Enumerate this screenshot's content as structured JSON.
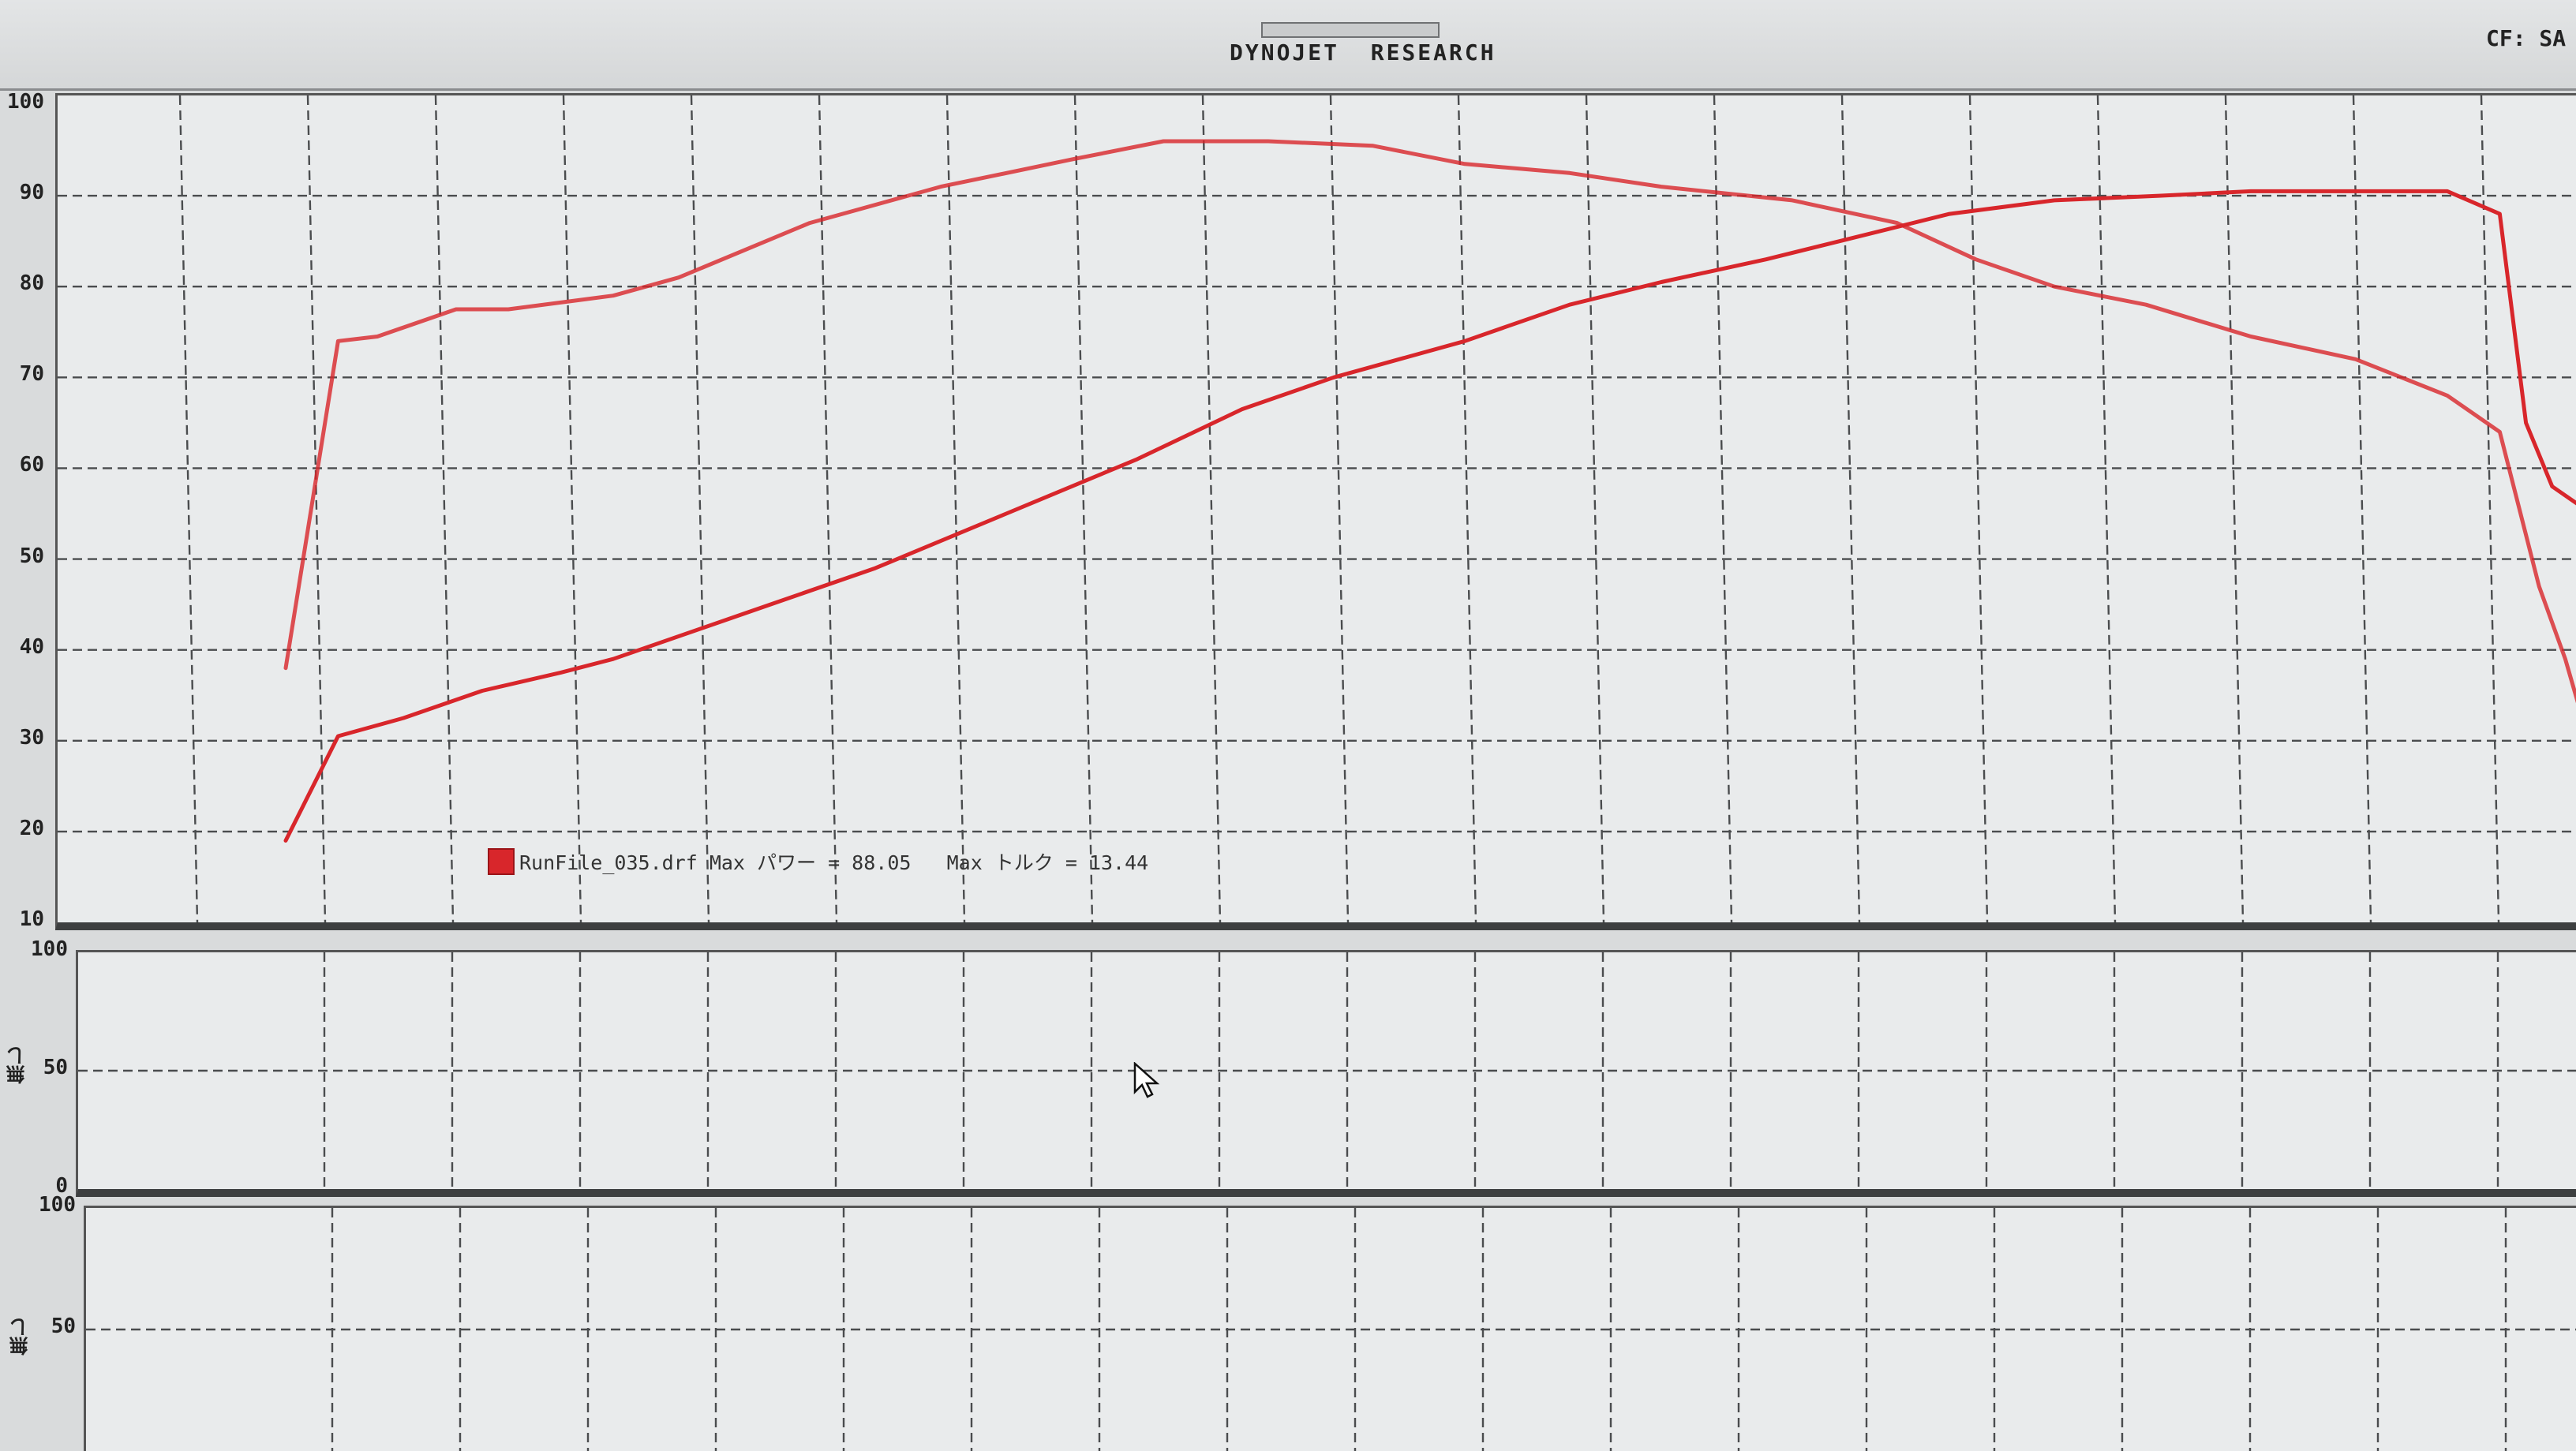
{
  "window": {
    "title": "DYNOJET  RESEARCH",
    "cf_label": "CF: SA"
  },
  "colors": {
    "curve": "#d8262b",
    "grid": "#4a4c4e",
    "panel_bg": "#e9ebec"
  },
  "icons": [
    "cursor-arrow-icon"
  ],
  "chart_data": [
    {
      "type": "line",
      "ylim": [
        10,
        100
      ],
      "yticks": [
        "100",
        "90",
        "80",
        "70",
        "60",
        "50",
        "40",
        "30",
        "20",
        "10"
      ],
      "xlim": [
        0,
        19
      ],
      "legend": {
        "label": "RunFile_035.drf Max パワー = 88.05   Max トルク = 13.44",
        "placement": "bottom-left"
      },
      "series": [
        {
          "x": [
            1.5,
            1.8,
            1.9,
            2.2,
            2.8,
            3.2,
            4.0,
            4.5,
            5.5,
            6.5,
            7.5,
            8.2,
            9.0,
            9.8,
            10.5,
            11.3,
            12.0,
            13.0,
            13.8,
            14.4,
            15.0,
            15.7,
            16.5,
            17.3,
            18.0,
            18.4,
            18.7,
            18.9,
            19.0
          ],
          "y": [
            38,
            65,
            74,
            74.5,
            77.5,
            77.5,
            79,
            81,
            87,
            91,
            94,
            96,
            96,
            95.5,
            93.5,
            92.5,
            91,
            89.5,
            87,
            83,
            80,
            78,
            74.5,
            72,
            68,
            64,
            47,
            39,
            34
          ]
        },
        {
          "x": [
            1.5,
            1.9,
            2.4,
            3.0,
            3.6,
            4.0,
            5.0,
            6.0,
            7.0,
            8.0,
            8.8,
            9.5,
            10.5,
            11.3,
            12.0,
            12.8,
            13.5,
            14.2,
            15.0,
            15.8,
            16.5,
            17.2,
            18.0,
            18.4,
            18.6,
            18.8,
            19.0
          ],
          "y": [
            19,
            30.5,
            32.5,
            35.5,
            37.5,
            39,
            44,
            49,
            55,
            61,
            66.5,
            70,
            74,
            78,
            80.5,
            83,
            85.5,
            88,
            89.5,
            90,
            90.5,
            90.5,
            90.5,
            88,
            65,
            58,
            56
          ]
        }
      ]
    },
    {
      "type": "line",
      "ylim": [
        0,
        100
      ],
      "yticks": [
        "100",
        "50",
        "0"
      ],
      "ylabel": "無し",
      "series": []
    },
    {
      "type": "line",
      "ylim": [
        0,
        100
      ],
      "yticks": [
        "100",
        "50"
      ],
      "ylabel": "無し",
      "series": []
    }
  ]
}
